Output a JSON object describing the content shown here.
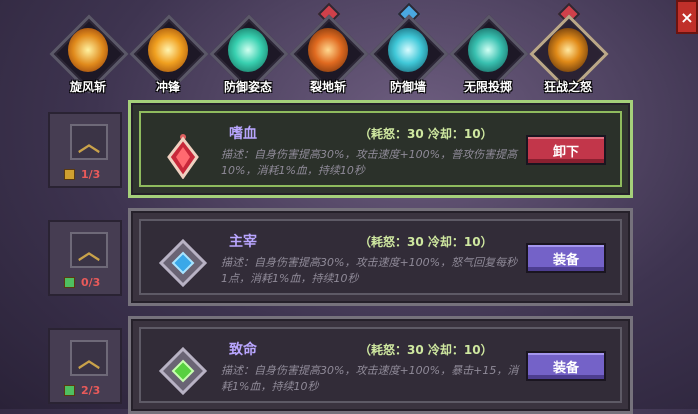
{
  "close_label": "×",
  "tabs": [
    {
      "label": "旋风斩",
      "gem": "none",
      "icon": "whirlwind-icon",
      "color": "#e08a1c"
    },
    {
      "label": "冲锋",
      "gem": "none",
      "icon": "charge-icon",
      "color": "#f0a020"
    },
    {
      "label": "防御姿态",
      "gem": "none",
      "icon": "defense-stance-icon",
      "color": "#38d0b0"
    },
    {
      "label": "裂地斩",
      "gem": "red",
      "icon": "earth-split-icon",
      "color": "#e06a20"
    },
    {
      "label": "防御墙",
      "gem": "blue",
      "icon": "defense-wall-icon",
      "color": "#40c8d8"
    },
    {
      "label": "无限投掷",
      "gem": "none",
      "icon": "infinite-throw-icon",
      "color": "#38c0b0"
    },
    {
      "label": "狂战之怒",
      "gem": "red",
      "icon": "berserk-rage-icon",
      "color": "#e08a18",
      "selected": true
    }
  ],
  "rows": [
    {
      "name": "嗜血",
      "cost": "（耗怒：30  冷却：10）",
      "desc": "描述：自身伤害提高30%，攻击速度+100%，普攻伤害提高10%，消耗1%血，持续10秒",
      "level": "1/3",
      "button": "卸下",
      "active": true,
      "icon": "bloodthirst-icon"
    },
    {
      "name": "主宰",
      "cost": "（耗怒：30  冷却：10）",
      "desc": "描述：自身伤害提高30%，攻击速度+100%，怒气回复每秒1点，消耗1%血，持续10秒",
      "level": "0/3",
      "button": "装备",
      "active": false,
      "icon": "dominate-icon"
    },
    {
      "name": "致命",
      "cost": "（耗怒：30  冷却：10）",
      "desc": "描述：自身伤害提高30%，攻击速度+100%，暴击+15，消耗1%血，持续10秒",
      "level": "2/3",
      "button": "装备",
      "active": false,
      "icon": "lethal-icon"
    }
  ]
}
